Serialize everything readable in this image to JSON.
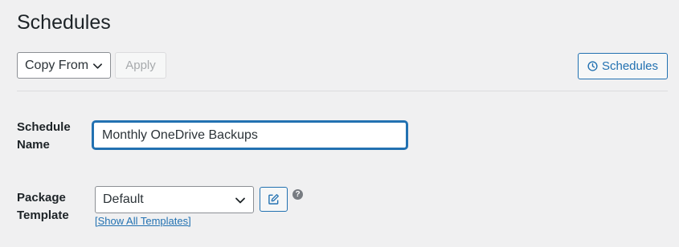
{
  "page": {
    "title": "Schedules"
  },
  "toolbar": {
    "copy_from": {
      "selected": "Copy From"
    },
    "apply_label": "Apply",
    "schedules_label": "Schedules"
  },
  "form": {
    "schedule_name": {
      "label": "Schedule Name",
      "value": "Monthly OneDrive Backups"
    },
    "package_template": {
      "label": "Package Template",
      "selected": "Default",
      "show_all_label": "[Show All Templates]"
    }
  },
  "icons": {
    "schedules_button": "clock-icon",
    "edit_button": "edit-icon",
    "help": "help-icon"
  },
  "colors": {
    "accent": "#2271b1",
    "background": "#f0f0f1",
    "disabled_text": "#a7aaad"
  }
}
